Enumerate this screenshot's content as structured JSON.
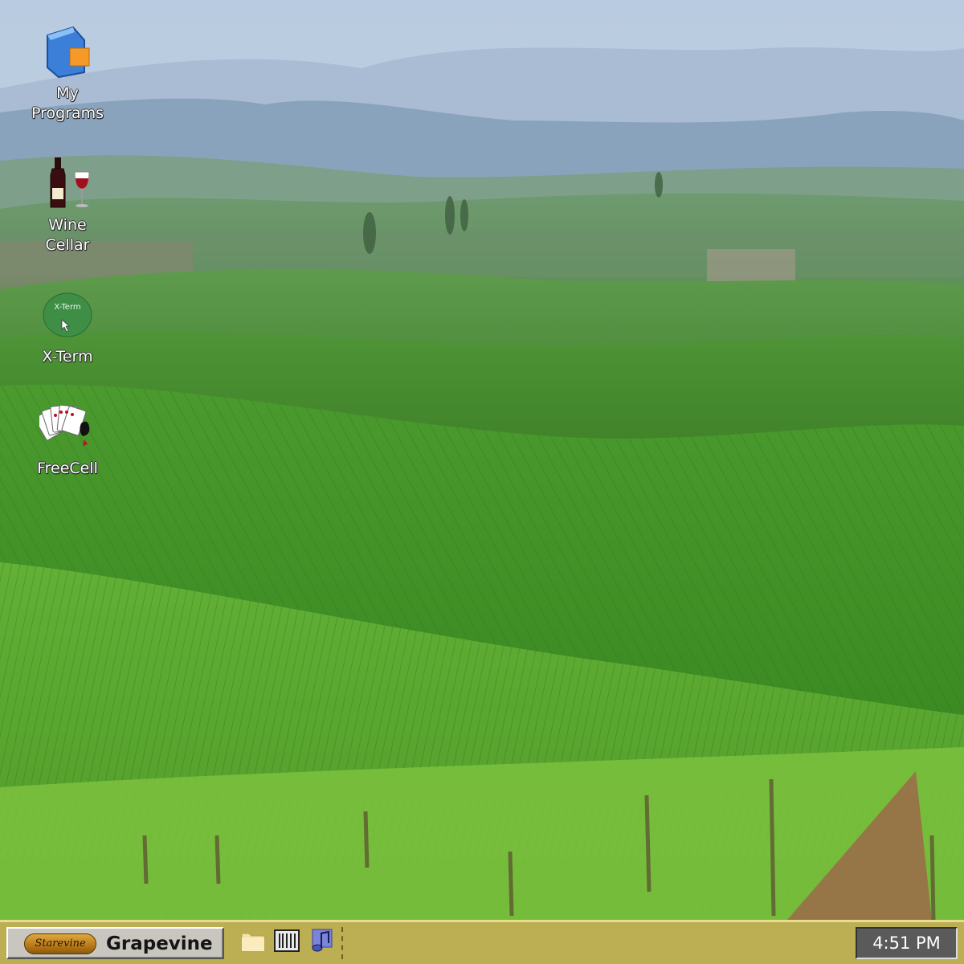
{
  "desktop": {
    "icons": [
      {
        "label": "My\nPrograms",
        "icon": "folder-icon"
      },
      {
        "label": "Wine\nCellar",
        "icon": "wine-bottle-glass-icon"
      },
      {
        "label": "X-Term",
        "icon": "terminal-icon",
        "badge": "X-Term"
      },
      {
        "label": "FreeCell",
        "icon": "playing-cards-icon"
      }
    ]
  },
  "taskbar": {
    "start_logo_text": "Starevine",
    "start_label": "Grapevine",
    "quick_launch": [
      {
        "icon": "folder-icon"
      },
      {
        "icon": "terminal-app-icon"
      },
      {
        "icon": "music-note-icon"
      }
    ],
    "clock": "4:51 PM"
  },
  "colors": {
    "taskbar": "#bcae52",
    "start_button": "#c9c6c0",
    "clock_bg": "#5a5a5a",
    "xterm_icon": "#3e8e46"
  }
}
